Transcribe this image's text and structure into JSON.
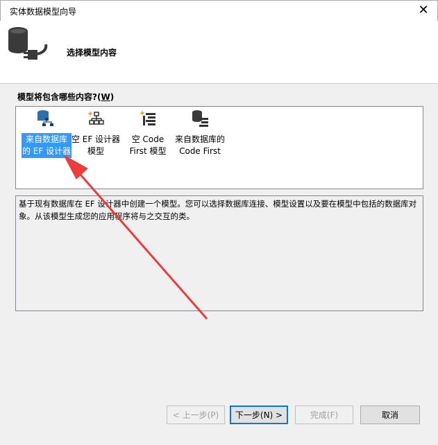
{
  "window": {
    "title": "实体数据模型向导",
    "close_glyph": "✕"
  },
  "header": {
    "title": "选择模型内容",
    "icon": "database-plug-icon"
  },
  "section": {
    "label": "模型将包含哪些内容?",
    "accel": "W"
  },
  "items": [
    {
      "line1": "来自数据库",
      "line2": "的 EF 设计器",
      "icon": "database-hierarchy-icon",
      "selected": true
    },
    {
      "line1": "空 EF 设计器",
      "line2": "模型",
      "icon": "hierarchy-sparkle-icon",
      "selected": false
    },
    {
      "line1": "空 Code",
      "line2": "First 模型",
      "icon": "code-first-sparkle-icon",
      "selected": false
    },
    {
      "line1": "来自数据库的",
      "line2": "Code First",
      "icon": "database-code-first-icon",
      "selected": false
    }
  ],
  "description": "基于现有数据库在 EF 设计器中创建一个模型。您可以选择数据库连接、模型设置以及要在模型中包括的数据库对象。从该模型生成您的应用程序将与之交互的类。",
  "buttons": {
    "prev": "< 上一步(P)",
    "next": "下一步(N) >",
    "finish": "完成(F)",
    "cancel": "取消"
  },
  "colors": {
    "selection": "#3399ff",
    "annotation_arrow": "#ef3b3b"
  }
}
